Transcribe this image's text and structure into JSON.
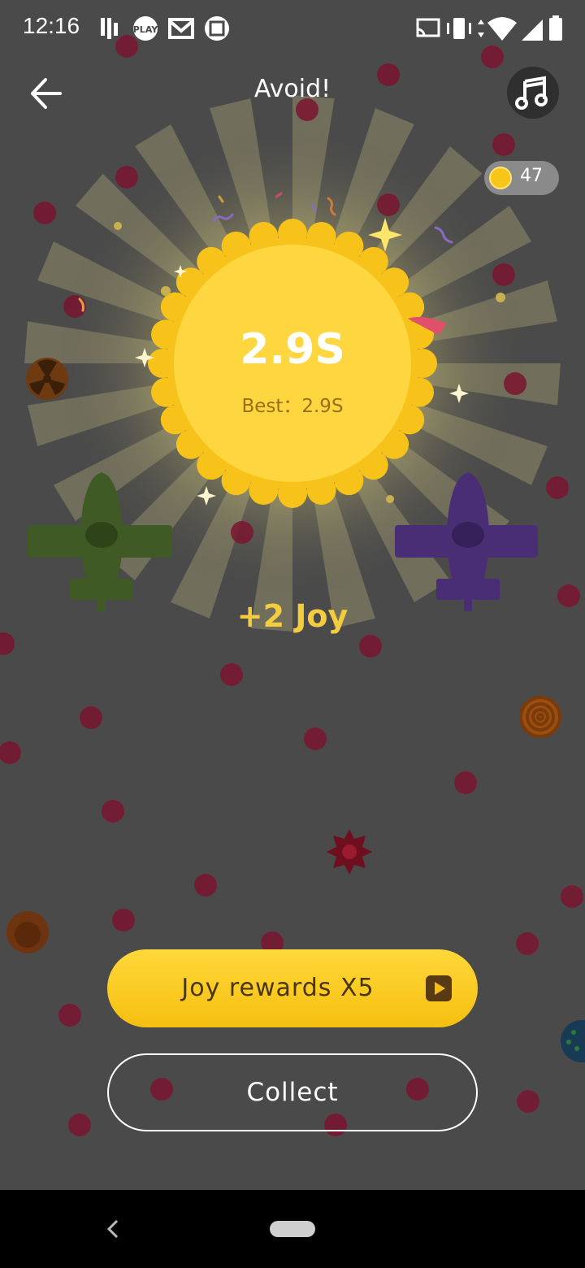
{
  "status_bar": {
    "time": "12:16",
    "left_icons": [
      "bars-icon",
      "play-icon",
      "gmail-icon",
      "photo-icon"
    ],
    "right_icons": [
      "cast-icon",
      "vibrate-icon",
      "wifi-icon",
      "signal-icon",
      "battery-icon"
    ]
  },
  "header": {
    "title": "Avoid!"
  },
  "coins": {
    "count": "47"
  },
  "result": {
    "score": "2.9S",
    "best_label": "Best：",
    "best_value": "2.9S",
    "best_text": "Best：2.9S",
    "reward": "+2 Joy"
  },
  "buttons": {
    "joy_rewards": "Joy rewards X5",
    "collect": "Collect"
  },
  "colors": {
    "background": "#4a4a4a",
    "accent_yellow": "#f6bf10",
    "reward_text": "#f4cd3f",
    "dots": "#7a1530",
    "green_plane": "#3f5a25",
    "purple_plane": "#4a2e75"
  }
}
